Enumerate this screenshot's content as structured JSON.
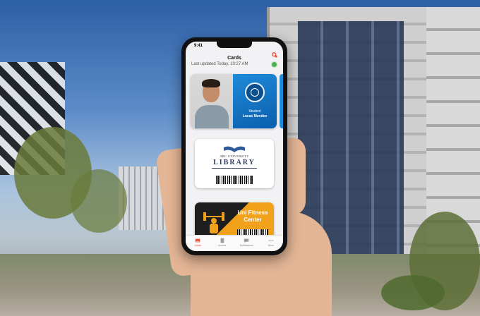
{
  "app": {
    "title": "Cards",
    "status_time": "9:41",
    "last_updated": "Last updated Today, 10:27 AM"
  },
  "cards": {
    "student": {
      "role": "Student",
      "name": "Lucas Mendes",
      "color": "#1e8ad8"
    },
    "library": {
      "university": "ABC UNIVERSITY",
      "name": "LIBRARY",
      "color": "#2f3d63"
    },
    "gym": {
      "title": "Uni Fitness Center",
      "color": "#f1a21a"
    }
  },
  "pager": {
    "count": 2,
    "active": 0
  },
  "tabs": [
    {
      "label": "Cards",
      "icon": "card-icon",
      "active": true
    },
    {
      "label": "Access",
      "icon": "door-icon",
      "active": false
    },
    {
      "label": "Notifications",
      "icon": "chat-icon",
      "active": false
    },
    {
      "label": "More",
      "icon": "more-icon",
      "active": false
    }
  ],
  "accent_color": "#e8492f"
}
